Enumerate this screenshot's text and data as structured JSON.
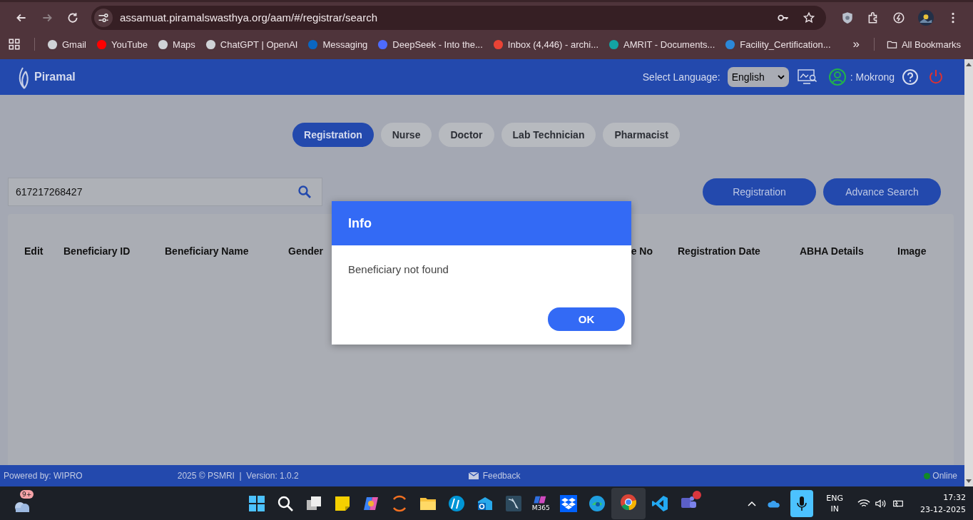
{
  "browser": {
    "url": "assamuat.piramalswasthya.org/aam/#/registrar/search",
    "bookmarks": [
      {
        "label": "Gmail"
      },
      {
        "label": "YouTube"
      },
      {
        "label": "Maps"
      },
      {
        "label": "ChatGPT | OpenAI"
      },
      {
        "label": "Messaging"
      },
      {
        "label": "DeepSeek - Into the..."
      },
      {
        "label": "Inbox (4,446) - archi..."
      },
      {
        "label": "AMRIT - Documents..."
      },
      {
        "label": "Facility_Certification..."
      }
    ],
    "overflow": "»",
    "all_bookmarks": "All Bookmarks"
  },
  "header": {
    "brand": "Piramal",
    "language_label": "Select Language:",
    "language": "English",
    "user": ": Mokrong"
  },
  "role_tabs": [
    {
      "label": "Registration",
      "selected": true
    },
    {
      "label": "Nurse",
      "selected": false
    },
    {
      "label": "Doctor",
      "selected": false
    },
    {
      "label": "Lab Technician",
      "selected": false
    },
    {
      "label": "Pharmacist",
      "selected": false
    }
  ],
  "search": {
    "value": "617217268427"
  },
  "actions": [
    "Registration",
    "Advance Search"
  ],
  "table": {
    "columns": [
      "Edit",
      "Beneficiary ID",
      "Beneficiary Name",
      "Gender",
      "e No",
      "Registration Date",
      "ABHA Details",
      "Image"
    ]
  },
  "dialog": {
    "title": "Info",
    "message": "Beneficiary not found",
    "button": "OK"
  },
  "footer": {
    "powered": "Powered by: WIPRO",
    "version": "2025 © PSMRI  |  Version: 1.0.2",
    "feedback": "Feedback",
    "status": "Online"
  },
  "taskbar": {
    "weather_badge": "9+",
    "m365": "M365",
    "lang": "ENG",
    "region": "IN",
    "time": "17:32",
    "date": "23-12-2025"
  }
}
